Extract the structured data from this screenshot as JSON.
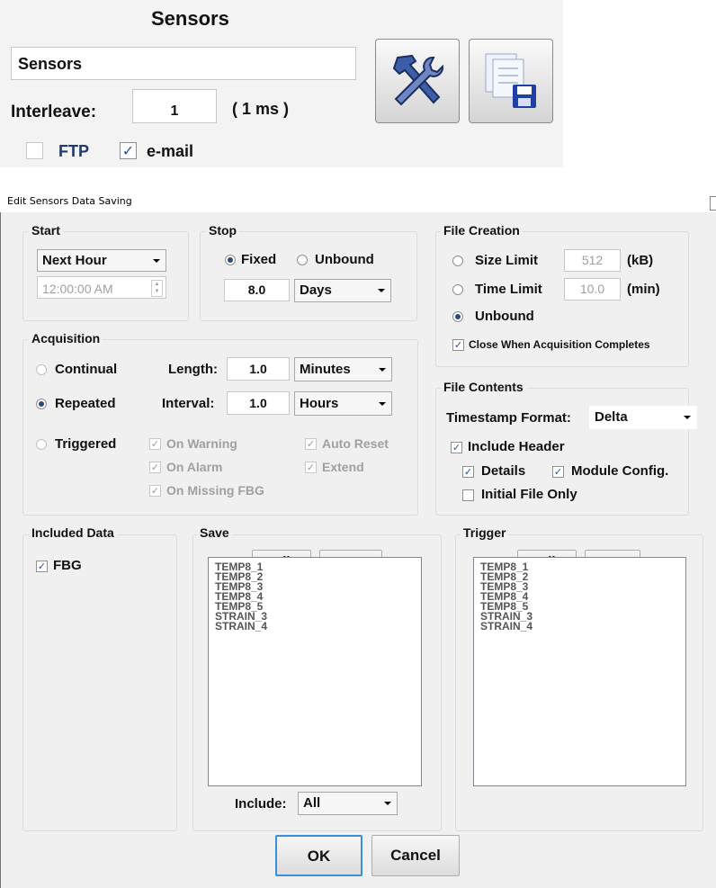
{
  "top_panel": {
    "title": "Sensors",
    "name_value": "Sensors",
    "interleave_label": "Interleave:",
    "interleave_value": "1",
    "interleave_unit": "( 1 ms )",
    "ftp_label": "FTP",
    "ftp_checked": false,
    "email_label": "e-mail",
    "email_checked": true,
    "settings_icon": "tools-icon",
    "save_icon": "save-files-icon"
  },
  "dialog": {
    "title": "Edit Sensors Data Saving",
    "start": {
      "label": "Start",
      "mode": "Next Hour",
      "time": "12:00:00 AM"
    },
    "stop": {
      "label": "Stop",
      "fixed_label": "Fixed",
      "unbound_label": "Unbound",
      "selected": "Fixed",
      "value": "8.0",
      "unit": "Days"
    },
    "file_creation": {
      "label": "File Creation",
      "size_limit_label": "Size Limit",
      "size_limit_value": "512",
      "size_limit_unit": "(kB)",
      "time_limit_label": "Time Limit",
      "time_limit_value": "10.0",
      "time_limit_unit": "(min)",
      "unbound_label": "Unbound",
      "selected": "Unbound",
      "close_label": "Close When Acquisition Completes",
      "close_checked": true
    },
    "acquisition": {
      "label": "Acquisition",
      "continual_label": "Continual",
      "repeated_label": "Repeated",
      "triggered_label": "Triggered",
      "selected": "Repeated",
      "length_label": "Length:",
      "length_value": "1.0",
      "length_unit": "Minutes",
      "interval_label": "Interval:",
      "interval_value": "1.0",
      "interval_unit": "Hours",
      "on_warning_label": "On Warning",
      "on_alarm_label": "On Alarm",
      "on_missing_label": "On Missing FBG",
      "auto_reset_label": "Auto Reset",
      "extend_label": "Extend"
    },
    "file_contents": {
      "label": "File Contents",
      "timestamp_label": "Timestamp Format:",
      "timestamp_value": "Delta",
      "include_header_label": "Include Header",
      "include_header_checked": true,
      "details_label": "Details",
      "details_checked": true,
      "module_config_label": "Module Config.",
      "module_config_checked": true,
      "initial_file_label": "Initial File Only",
      "initial_file_checked": false
    },
    "included_data": {
      "label": "Included Data",
      "fbg_label": "FBG",
      "fbg_checked": true
    },
    "save": {
      "label": "Save",
      "all_label": "All",
      "none_label": "None",
      "items": [
        "TEMP8_1",
        "TEMP8_2",
        "TEMP8_3",
        "TEMP8_4",
        "TEMP8_5",
        "STRAIN_3",
        "STRAIN_4"
      ],
      "include_label": "Include:",
      "include_value": "All"
    },
    "trigger": {
      "label": "Trigger",
      "all_label": "All",
      "none_label": "None",
      "items": [
        "TEMP8_1",
        "TEMP8_2",
        "TEMP8_3",
        "TEMP8_4",
        "TEMP8_5",
        "STRAIN_3",
        "STRAIN_4"
      ]
    },
    "ok_label": "OK",
    "cancel_label": "Cancel"
  }
}
